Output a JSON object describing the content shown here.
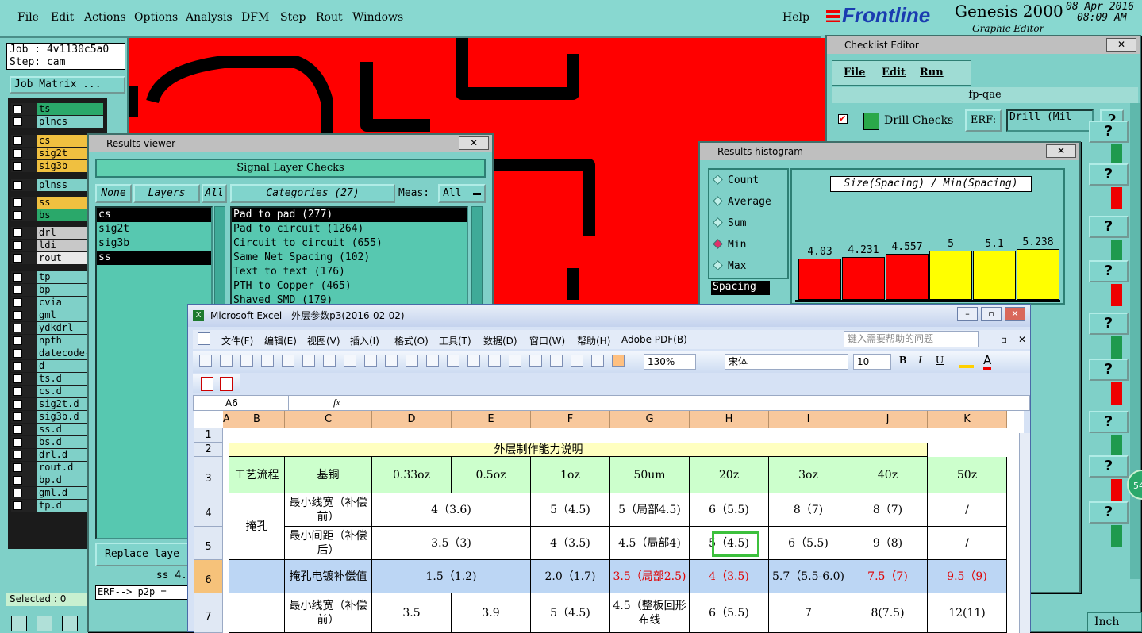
{
  "menubar": {
    "items": [
      "File",
      "Edit",
      "Actions",
      "Options",
      "Analysis",
      "DFM",
      "Step",
      "Rout",
      "Windows"
    ],
    "help": "Help"
  },
  "brand": {
    "logo": "Frontline",
    "product": "Genesis 2000",
    "subtitle": "Graphic Editor",
    "date": "08 Apr 2016",
    "time": "08:09 AM"
  },
  "left": {
    "job": "Job : 4v1130c5a0",
    "step": "Step: cam",
    "job_matrix": "Job Matrix ...",
    "selected": "Selected : 0",
    "layers": [
      {
        "name": "ts",
        "color": "#2aa86a"
      },
      {
        "name": "plncs",
        "color": "#7fd0c8"
      },
      {
        "name": "cs",
        "color": "#f0c040"
      },
      {
        "name": "sig2t",
        "color": "#f0c040"
      },
      {
        "name": "sig3b",
        "color": "#f0c040"
      },
      {
        "name": "plnss",
        "color": "#7fd0c8"
      },
      {
        "name": "ss",
        "color": "#f0c040"
      },
      {
        "name": "bs",
        "color": "#2aa86a"
      },
      {
        "name": "drl",
        "color": "#c8c8c8"
      },
      {
        "name": "ldi",
        "color": "#c8c8c8"
      },
      {
        "name": "rout",
        "color": "#e8e8e8"
      },
      {
        "name": "tp",
        "color": "#7fd0c8"
      },
      {
        "name": "bp",
        "color": "#7fd0c8"
      },
      {
        "name": "cvia",
        "color": "#7fd0c8"
      },
      {
        "name": "gml",
        "color": "#7fd0c8"
      },
      {
        "name": "ydkdrl",
        "color": "#7fd0c8"
      },
      {
        "name": "npth",
        "color": "#7fd0c8"
      },
      {
        "name": "datecode-",
        "color": "#7fd0c8"
      },
      {
        "name": "d",
        "color": "#7fd0c8"
      },
      {
        "name": "ts.d",
        "color": "#7fd0c8"
      },
      {
        "name": "cs.d",
        "color": "#7fd0c8"
      },
      {
        "name": "sig2t.d",
        "color": "#7fd0c8"
      },
      {
        "name": "sig3b.d",
        "color": "#7fd0c8"
      },
      {
        "name": "ss.d",
        "color": "#7fd0c8"
      },
      {
        "name": "bs.d",
        "color": "#7fd0c8"
      },
      {
        "name": "drl.d",
        "color": "#7fd0c8"
      },
      {
        "name": "rout.d",
        "color": "#7fd0c8"
      },
      {
        "name": "bp.d",
        "color": "#7fd0c8"
      },
      {
        "name": "gml.d",
        "color": "#7fd0c8"
      },
      {
        "name": "tp.d",
        "color": "#7fd0c8"
      }
    ]
  },
  "results_viewer": {
    "title": "Results viewer",
    "header": "Signal Layer Checks",
    "none": "None",
    "layers": "Layers",
    "all": "All",
    "categories": "Categories (27)",
    "meas_label": "Meas:",
    "meas_value": "All",
    "layer_list": [
      "cs",
      "sig2t",
      "sig3b",
      "ss"
    ],
    "category_list": [
      "Pad to pad (277)",
      "Pad to circuit (1264)",
      "Circuit to circuit (655)",
      "Same Net Spacing (102)",
      "Text to text (176)",
      "PTH to Copper (465)",
      "Shaved SMD (179)"
    ],
    "replace": "Replace laye",
    "status": "ss 4.",
    "erf": "ERF--> p2p ="
  },
  "checklist": {
    "title": "Checklist Editor",
    "menu": [
      "File",
      "Edit",
      "Run"
    ],
    "name": "fp-qae",
    "check": "Drill Checks",
    "erf_label": "ERF:",
    "erf_value": "Drill (Mil",
    "help": "?"
  },
  "histogram": {
    "title": "Results histogram",
    "options": [
      "Count",
      "Average",
      "Sum",
      "Min",
      "Max"
    ],
    "selected": "Min",
    "header": "Size(Spacing) / Min(Spacing)",
    "list_sel": "Spacing",
    "bars": [
      {
        "label": "4.03",
        "color": "#ff0000"
      },
      {
        "label": "4.231",
        "color": "#ff0000"
      },
      {
        "label": "4.557",
        "color": "#ff0000"
      },
      {
        "label": "5",
        "color": "#ffff00"
      },
      {
        "label": "5.1",
        "color": "#ffff00"
      },
      {
        "label": "5.238",
        "color": "#ffff00"
      }
    ]
  },
  "excel": {
    "title": "Microsoft Excel - 外层参数p3(2016-02-02)",
    "menu": [
      "文件(F)",
      "编辑(E)",
      "视图(V)",
      "插入(I)",
      "格式(O)",
      "工具(T)",
      "数据(D)",
      "窗口(W)",
      "帮助(H)",
      "Adobe PDF(B)"
    ],
    "help_placeholder": "键入需要帮助的问题",
    "zoom": "130%",
    "font": "宋体",
    "size": "10",
    "namebox": "A6",
    "fx": "fx",
    "cols": [
      "A",
      "B",
      "C",
      "D",
      "E",
      "F",
      "G",
      "H",
      "I",
      "J",
      "K"
    ],
    "rows": [
      "1",
      "2",
      "3",
      "4",
      "5",
      "6",
      "7"
    ],
    "title_row": "外层制作能力说明",
    "r3": [
      "工艺流程",
      "基铜",
      "0.33oz",
      "0.5oz",
      "1oz",
      "50um",
      "20z",
      "3oz",
      "40z",
      "50z"
    ],
    "r4": [
      "最小线宽（补偿前）",
      "4（3.6)",
      "5（4.5)",
      "5（局部4.5)",
      "6（5.5)",
      "8（7)",
      "8（7)",
      "/"
    ],
    "r5": [
      "掩孔",
      "最小间距（补偿后）",
      "3.5（3)",
      "4（3.5)",
      "4.5（局部4)",
      "5（4.5)",
      "6（5.5)",
      "9（8)",
      "/"
    ],
    "r6": [
      "掩孔电镀补偿值",
      "1.5（1.2)",
      "2.0（1.7)",
      "3.5（局部2.5)",
      "4（3.5)",
      "5.7（5.5-6.0)",
      "7.5（7)",
      "9.5（9)"
    ],
    "r7": [
      "最小线宽（补偿前）",
      "3.5",
      "3.9",
      "5（4.5)",
      "4.5（整板回形布线",
      "6（5.5)",
      "7",
      "8(7.5)",
      "12(11)"
    ]
  },
  "statusbar": {
    "unit": "Inch",
    "badge": "54"
  }
}
